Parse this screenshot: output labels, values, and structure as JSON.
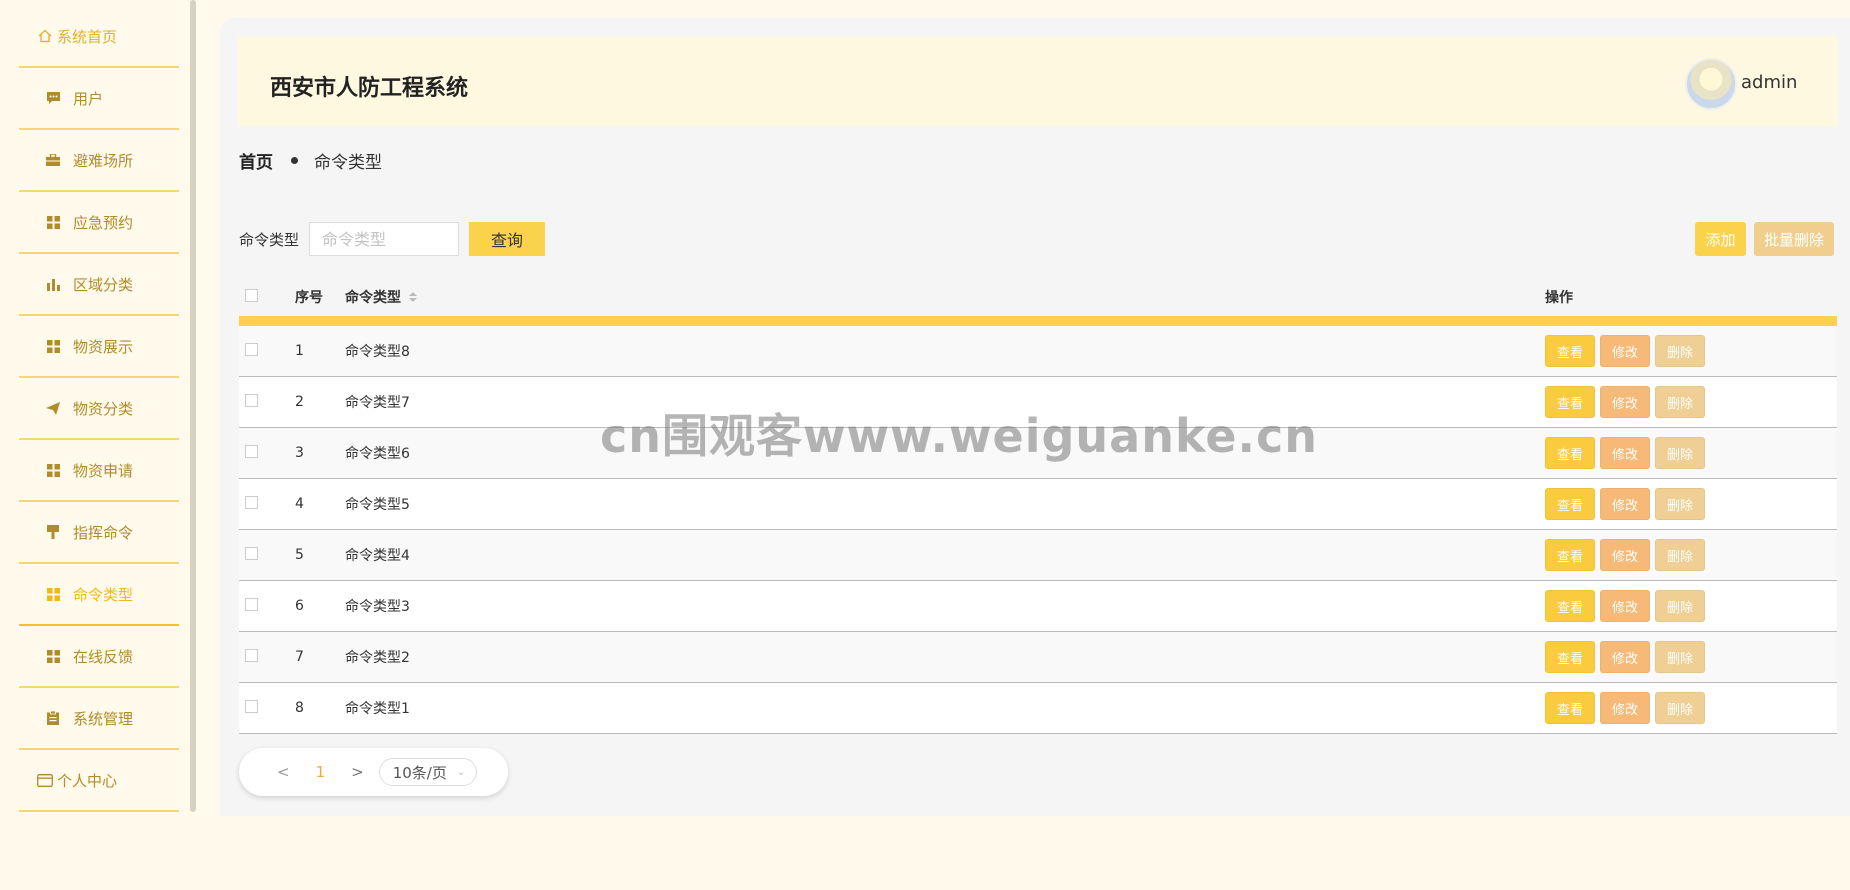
{
  "sidebar": {
    "items": [
      {
        "label": "系统首页",
        "icon": "home-icon"
      },
      {
        "label": "用户",
        "icon": "chat-icon"
      },
      {
        "label": "避难场所",
        "icon": "briefcase-icon"
      },
      {
        "label": "应急预约",
        "icon": "grid-icon"
      },
      {
        "label": "区域分类",
        "icon": "bar-chart-icon"
      },
      {
        "label": "物资展示",
        "icon": "grid-icon"
      },
      {
        "label": "物资分类",
        "icon": "send-icon"
      },
      {
        "label": "物资申请",
        "icon": "grid-icon"
      },
      {
        "label": "指挥命令",
        "icon": "brush-icon"
      },
      {
        "label": "命令类型",
        "icon": "grid-icon"
      },
      {
        "label": "在线反馈",
        "icon": "grid-icon"
      },
      {
        "label": "系统管理",
        "icon": "clipboard-icon"
      },
      {
        "label": "个人中心",
        "icon": "card-icon"
      }
    ],
    "active_index": 9
  },
  "header": {
    "title": "西安市人防工程系统",
    "username": "admin"
  },
  "breadcrumb": {
    "home": "首页",
    "current": "命令类型"
  },
  "search": {
    "label": "命令类型",
    "placeholder": "命令类型",
    "query_button": "查询"
  },
  "actions": {
    "add": "添加",
    "batch_delete": "批量删除"
  },
  "table": {
    "columns": {
      "index": "序号",
      "type": "命令类型",
      "ops": "操作"
    },
    "op_labels": {
      "view": "查看",
      "edit": "修改",
      "delete": "删除"
    },
    "rows": [
      {
        "index": "1",
        "type": "命令类型8"
      },
      {
        "index": "2",
        "type": "命令类型7"
      },
      {
        "index": "3",
        "type": "命令类型6"
      },
      {
        "index": "4",
        "type": "命令类型5"
      },
      {
        "index": "5",
        "type": "命令类型4"
      },
      {
        "index": "6",
        "type": "命令类型3"
      },
      {
        "index": "7",
        "type": "命令类型2"
      },
      {
        "index": "8",
        "type": "命令类型1"
      }
    ]
  },
  "pagination": {
    "prev": "<",
    "page": "1",
    "next": ">",
    "page_size": "10条/页"
  },
  "watermark": "cn围观客www.weiguanke.cn",
  "colors": {
    "accent": "#fbd24c",
    "sidebar_text": "#b08c2a",
    "active": "#f2b81b",
    "edit": "#f7b978",
    "delete": "#efcf93"
  }
}
